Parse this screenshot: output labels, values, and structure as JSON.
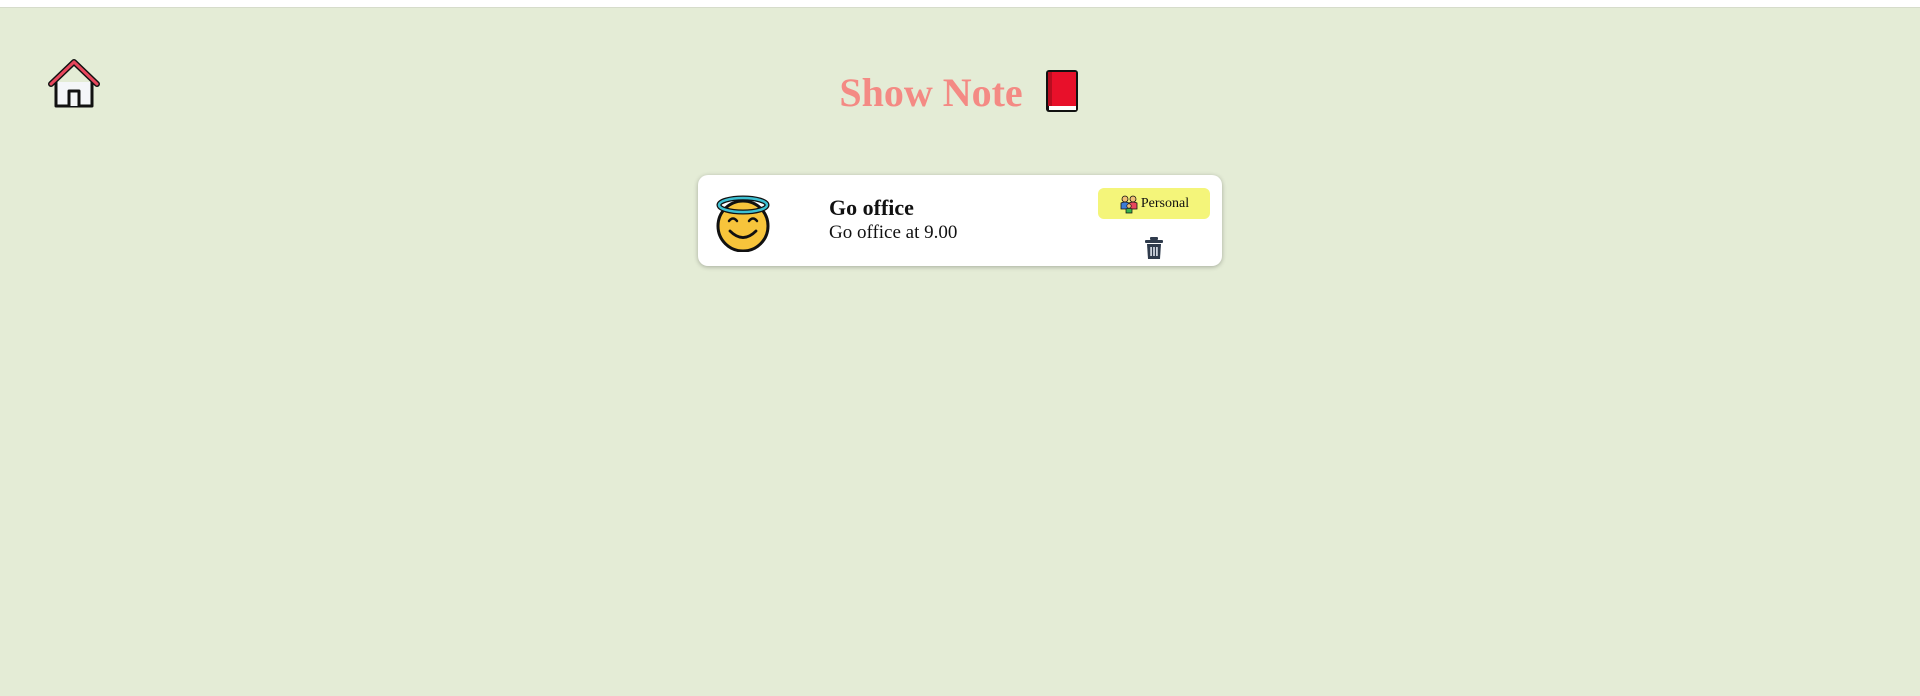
{
  "header": {
    "title": "Show Note",
    "title_color": "#f48a84",
    "home_icon": "house-icon",
    "title_icon": "closed-red-book-icon"
  },
  "page": {
    "background": "#e4ecd6"
  },
  "notes": [
    {
      "emoji_icon": "smiling-face-with-halo-icon",
      "title": "Go office",
      "body": "Go office at 9.00",
      "category": {
        "label": "Personal",
        "icon": "family-icon",
        "color": "#f4f57a"
      },
      "delete_icon": "trash-can-icon"
    }
  ]
}
